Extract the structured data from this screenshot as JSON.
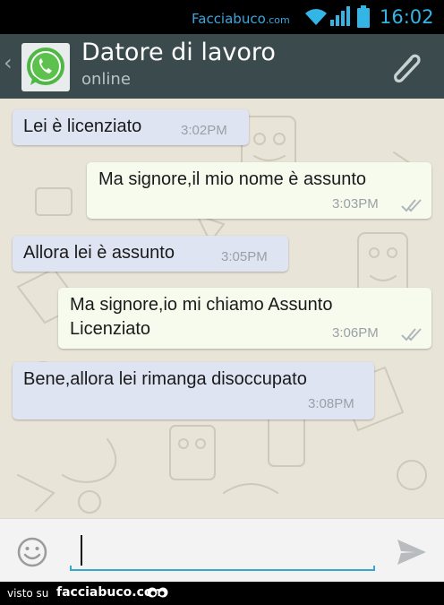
{
  "status_bar": {
    "brand": "Facciabuco",
    "brand_suffix": ".com",
    "time": "16:02",
    "icons": [
      "wifi-icon",
      "signal-icon",
      "battery-icon"
    ]
  },
  "header": {
    "title": "Datore di lavoro",
    "status": "online",
    "icons": [
      "back-chevron-icon",
      "whatsapp-logo",
      "attachment-icon"
    ],
    "background": "#3b4a4c"
  },
  "messages": [
    {
      "direction": "incoming",
      "text": "Lei è licenziato",
      "time": "3:02PM"
    },
    {
      "direction": "outgoing",
      "text": "Ma signore,il mio nome è assunto",
      "time": "3:03PM",
      "read": true
    },
    {
      "direction": "incoming",
      "text": "Allora lei è assunto",
      "time": "3:05PM"
    },
    {
      "direction": "outgoing",
      "text_line1": "Ma signore,io mi chiamo Assunto",
      "text_line2": "Licenziato",
      "time": "3:06PM",
      "read": true
    },
    {
      "direction": "incoming",
      "text": "Bene,allora lei rimanga disoccupato",
      "time": "3:08PM"
    }
  ],
  "input": {
    "value": "",
    "icons": [
      "emoji-icon",
      "send-icon"
    ],
    "accent": "#39a8cf"
  },
  "footer": {
    "visto": "visto su",
    "brand": "facciabuco.com"
  },
  "colors": {
    "incoming_bubble": "#dfe4f3",
    "outgoing_bubble": "#f6fbee",
    "chat_background": "#e8e4d8",
    "time_accent": "#33b5e5"
  }
}
